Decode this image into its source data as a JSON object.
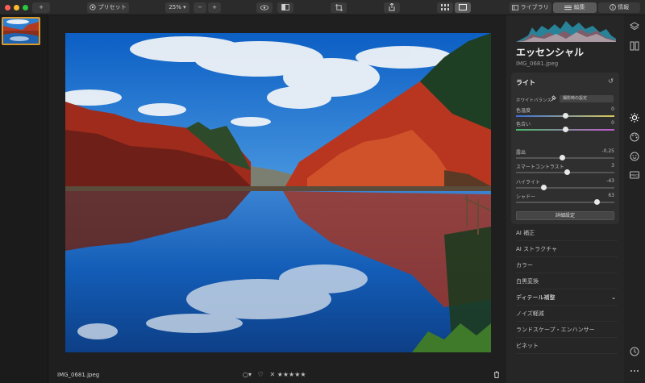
{
  "toolbar": {
    "add_symbol": "+",
    "presets_label": "プリセット",
    "zoom_value": "25%",
    "zoom_out": "−",
    "zoom_in": "+",
    "library_label": "ライブラリ",
    "edit_label": "編集",
    "info_label": "情報"
  },
  "canvas": {
    "filename": "IMG_0681.jpeg",
    "rating_stars": "✕ ★★★★★"
  },
  "panel": {
    "title": "エッセンシャル",
    "file": "IMG_0681.jpeg",
    "light": {
      "header": "ライト",
      "white_balance_label": "ホワイトバランス",
      "white_balance_value": "撮影時の設定",
      "detail_button": "詳細設定",
      "sliders": [
        {
          "label": "色温度",
          "value": "0",
          "level": 0.5
        },
        {
          "label": "色合い",
          "value": "0",
          "level": 0.5
        },
        {
          "label": "露出",
          "value": "-0.25",
          "level": 0.47
        },
        {
          "label": "スマートコントラスト",
          "value": "3",
          "level": 0.52
        },
        {
          "label": "ハイライト",
          "value": "-43",
          "level": 0.28
        },
        {
          "label": "シャドー",
          "value": "63",
          "level": 0.82
        }
      ]
    },
    "sections": [
      "AI 補正",
      "AI ストラクチャ",
      "カラー",
      "白黒変換",
      "ディテール補整",
      "ノイズ軽減",
      "ランドスケープ・エンハンサー",
      "ビネット"
    ]
  },
  "colors": {
    "accent_thumb_border": "#d99a2b",
    "panel_bg": "#262626",
    "light_box_bg": "#2f2f2f"
  }
}
